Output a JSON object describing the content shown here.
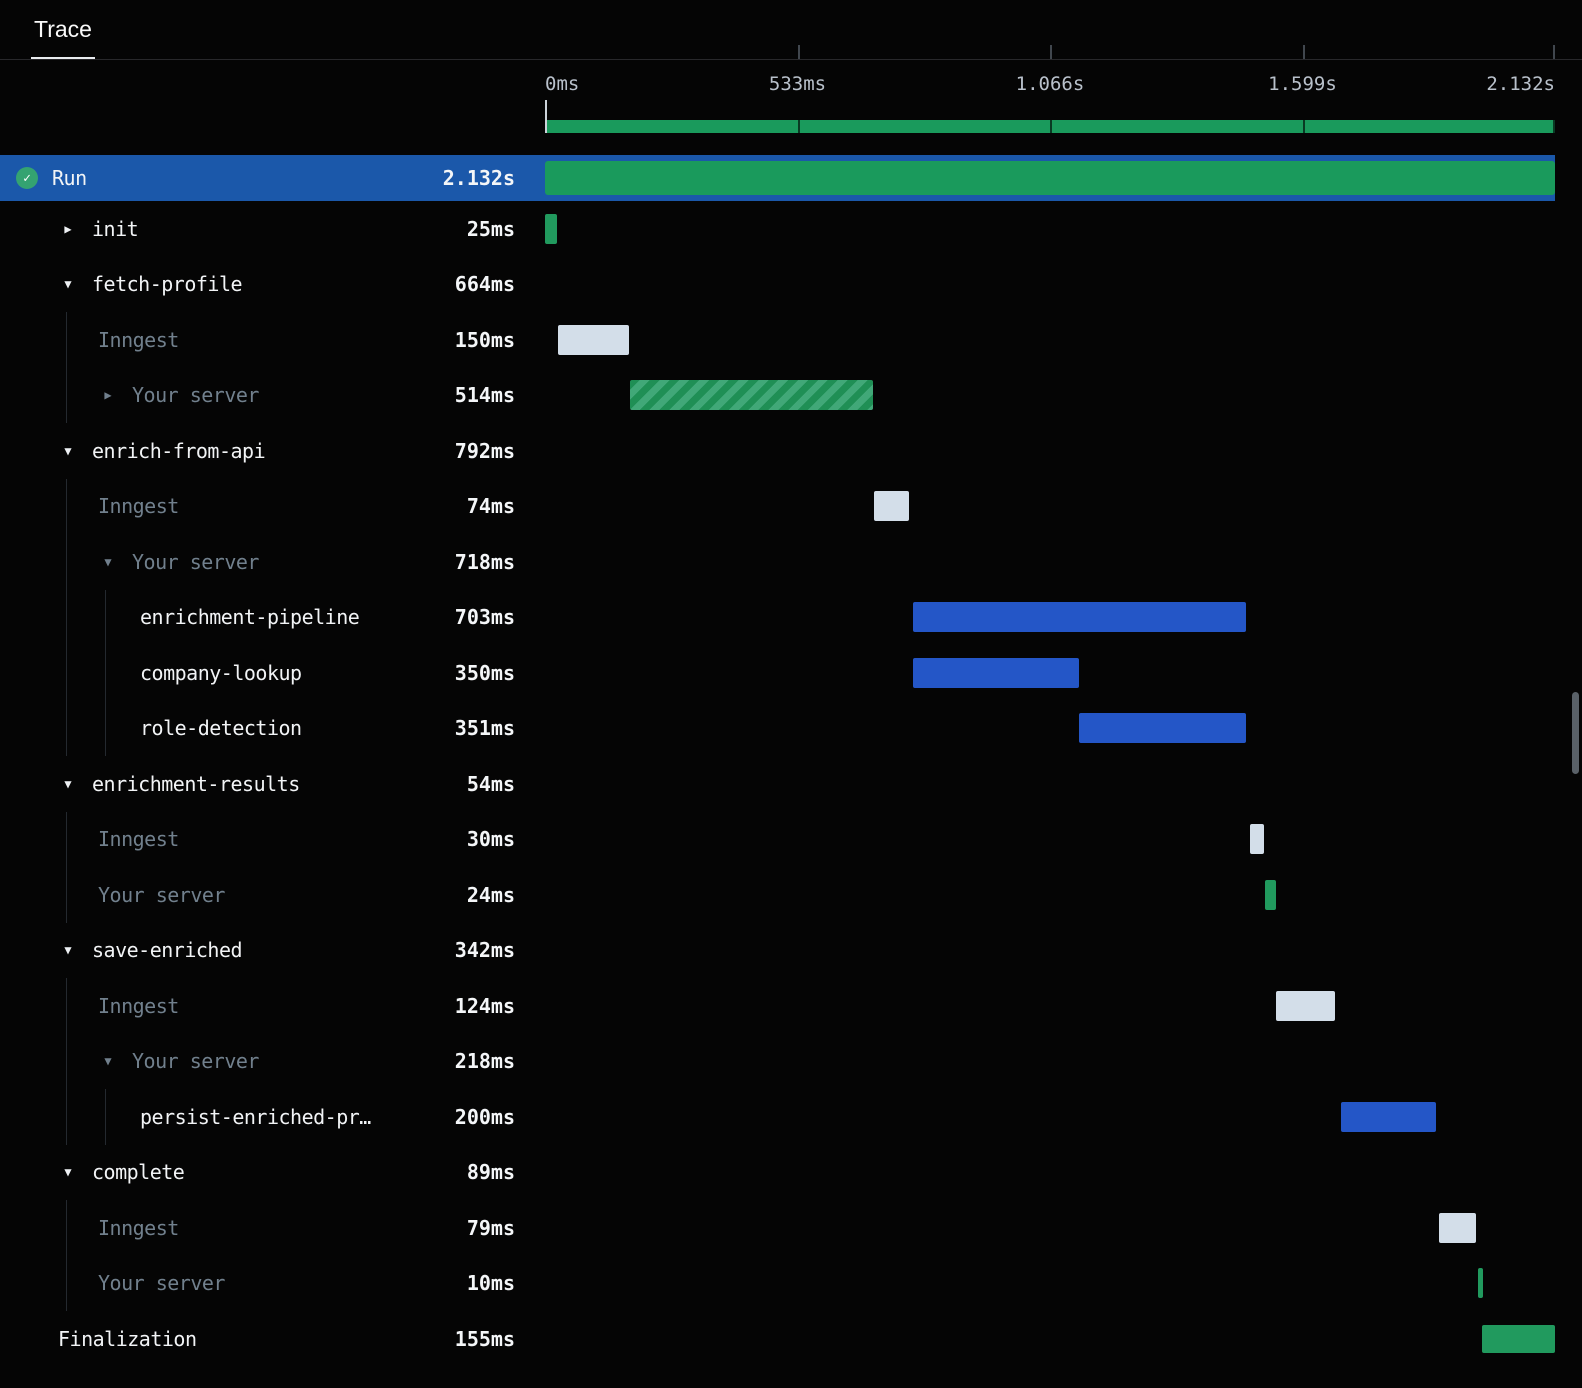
{
  "tab": {
    "label": "Trace"
  },
  "timeline": {
    "total_ms": 2132,
    "axis_labels": [
      "0ms",
      "533ms",
      "1.066s",
      "1.599s",
      "2.132s"
    ]
  },
  "colors": {
    "selected_row_blue": "#1b58aa",
    "run_bar_green": "#1a9a5c",
    "execution_blue": "#2456c7",
    "queue_gray": "#d3dee9",
    "server_green": "#219a5e",
    "hatch_dark_green": "#1f8f55",
    "hatch_light_green": "#41a878"
  },
  "rows": [
    {
      "name": "Run",
      "duration": "2.132s",
      "level": 0,
      "selected": true,
      "icon": "check-circle",
      "expander": null,
      "muted": false,
      "bar": {
        "start": 0,
        "duration": 2132,
        "kind": "run"
      }
    },
    {
      "name": "init",
      "duration": "25ms",
      "level": 1,
      "expander": "closed",
      "muted": false,
      "bar": {
        "start": 0,
        "duration": 25,
        "kind": "green"
      }
    },
    {
      "name": "fetch-profile",
      "duration": "664ms",
      "level": 1,
      "expander": "open",
      "muted": false,
      "bar": null
    },
    {
      "name": "Inngest",
      "duration": "150ms",
      "level": 2,
      "expander": null,
      "muted": true,
      "bar": {
        "start": 27,
        "duration": 150,
        "kind": "queue"
      }
    },
    {
      "name": "Your server",
      "duration": "514ms",
      "level": 2,
      "expander": "closed",
      "muted": true,
      "bar": {
        "start": 179,
        "duration": 514,
        "kind": "hatched"
      }
    },
    {
      "name": "enrich-from-api",
      "duration": "792ms",
      "level": 1,
      "expander": "open",
      "muted": false,
      "bar": null
    },
    {
      "name": "Inngest",
      "duration": "74ms",
      "level": 2,
      "expander": null,
      "muted": true,
      "bar": {
        "start": 694,
        "duration": 74,
        "kind": "queue"
      }
    },
    {
      "name": "Your server",
      "duration": "718ms",
      "level": 2,
      "expander": "open",
      "muted": true,
      "bar": null
    },
    {
      "name": "enrichment-pipeline",
      "duration": "703ms",
      "level": 3,
      "expander": null,
      "muted": false,
      "bar": {
        "start": 777,
        "duration": 703,
        "kind": "exec"
      }
    },
    {
      "name": "company-lookup",
      "duration": "350ms",
      "level": 3,
      "expander": null,
      "muted": false,
      "bar": {
        "start": 777,
        "duration": 350,
        "kind": "exec"
      }
    },
    {
      "name": "role-detection",
      "duration": "351ms",
      "level": 3,
      "expander": null,
      "muted": false,
      "bar": {
        "start": 1128,
        "duration": 351,
        "kind": "exec"
      }
    },
    {
      "name": "enrichment-results",
      "duration": "54ms",
      "level": 1,
      "expander": "open",
      "muted": false,
      "bar": null
    },
    {
      "name": "Inngest",
      "duration": "30ms",
      "level": 2,
      "expander": null,
      "muted": true,
      "bar": {
        "start": 1488,
        "duration": 30,
        "kind": "queue"
      }
    },
    {
      "name": "Your server",
      "duration": "24ms",
      "level": 2,
      "expander": null,
      "muted": true,
      "bar": {
        "start": 1520,
        "duration": 24,
        "kind": "green"
      }
    },
    {
      "name": "save-enriched",
      "duration": "342ms",
      "level": 1,
      "expander": "open",
      "muted": false,
      "bar": null
    },
    {
      "name": "Inngest",
      "duration": "124ms",
      "level": 2,
      "expander": null,
      "muted": true,
      "bar": {
        "start": 1543,
        "duration": 124,
        "kind": "queue"
      }
    },
    {
      "name": "Your server",
      "duration": "218ms",
      "level": 2,
      "expander": "open",
      "muted": true,
      "bar": null
    },
    {
      "name": "persist-enriched-pr…",
      "duration": "200ms",
      "level": 3,
      "expander": null,
      "muted": false,
      "bar": {
        "start": 1680,
        "duration": 200,
        "kind": "exec"
      }
    },
    {
      "name": "complete",
      "duration": "89ms",
      "level": 1,
      "expander": "open",
      "muted": false,
      "bar": null
    },
    {
      "name": "Inngest",
      "duration": "79ms",
      "level": 2,
      "expander": null,
      "muted": true,
      "bar": {
        "start": 1887,
        "duration": 79,
        "kind": "queue"
      }
    },
    {
      "name": "Your server",
      "duration": "10ms",
      "level": 2,
      "expander": null,
      "muted": true,
      "bar": {
        "start": 1970,
        "duration": 10,
        "kind": "green"
      }
    },
    {
      "name": "Finalization",
      "duration": "155ms",
      "level": 1,
      "expander": null,
      "muted": false,
      "bar": {
        "start": 1977,
        "duration": 155,
        "kind": "final"
      }
    }
  ]
}
